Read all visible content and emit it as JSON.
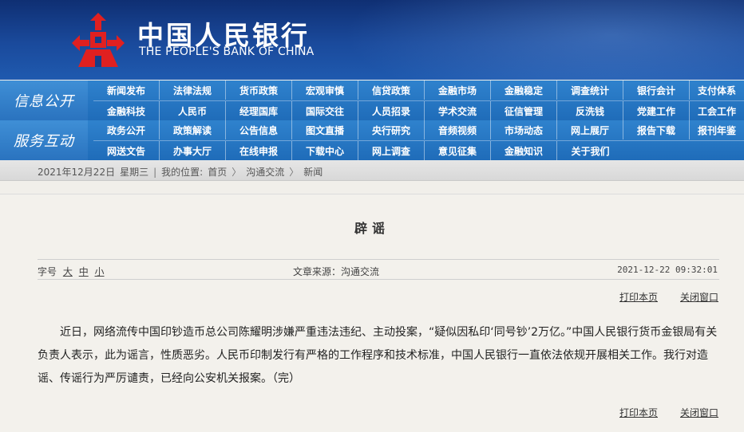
{
  "header": {
    "cn_name": "中国人民银行",
    "en_name": "THE PEOPLE'S BANK OF CHINA",
    "logo_icon": "pboc-logo-icon",
    "logo_color": "#e02020",
    "banner_color": "#163d88"
  },
  "nav_info": {
    "label": "信息公开",
    "row1": [
      "新闻发布",
      "法律法规",
      "货币政策",
      "宏观审慎",
      "信贷政策",
      "金融市场",
      "金融稳定",
      "调查统计",
      "银行会计",
      "支付体系"
    ],
    "row2": [
      "金融科技",
      "人民币",
      "经理国库",
      "国际交往",
      "人员招录",
      "学术交流",
      "征信管理",
      "反洗钱",
      "党建工作",
      "工会工作"
    ]
  },
  "nav_service": {
    "label": "服务互动",
    "row1": [
      "政务公开",
      "政策解读",
      "公告信息",
      "图文直播",
      "央行研究",
      "音频视频",
      "市场动态",
      "网上展厅",
      "报告下载",
      "报刊年鉴"
    ],
    "row2": [
      "网送文告",
      "办事大厅",
      "在线申报",
      "下载中心",
      "网上调查",
      "意见征集",
      "金融知识",
      "关于我们"
    ]
  },
  "breadcrumb": {
    "date": "2021年12月22日",
    "weekday": "星期三",
    "divider": "|",
    "location_label": "我的位置:",
    "items": [
      "首页",
      "沟通交流",
      "新闻"
    ],
    "arrow": "〉"
  },
  "article": {
    "title": "辟谣",
    "font_label": "字号",
    "font_large": "大",
    "font_medium": "中",
    "font_small": "小",
    "source": "文章来源：沟通交流",
    "datetime": "2021-12-22 09:32:01",
    "print_label": "打印本页",
    "close_label": "关闭窗口",
    "body": "近日，网络流传中国印钞造币总公司陈耀明涉嫌严重违法违纪、主动投案，“疑似因私印‘同号钞’2万亿。”中国人民银行货币金银局有关负责人表示，此为谣言，性质恶劣。人民币印制发行有严格的工作程序和技术标准，中国人民银行一直依法依规开展相关工作。我行对造谣、传谣行为严厉谴责，已经向公安机关报案。（完）"
  }
}
